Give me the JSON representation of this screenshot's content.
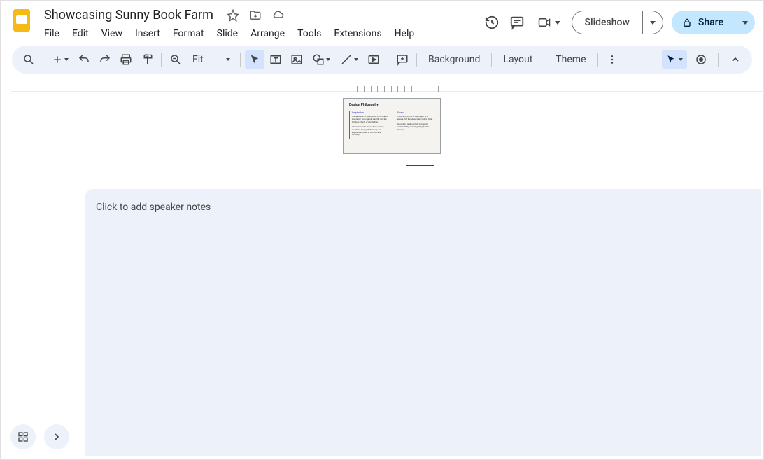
{
  "header": {
    "doc_title": "Showcasing Sunny Book Farm",
    "slideshow_label": "Slideshow",
    "share_label": "Share"
  },
  "menubar": [
    "File",
    "Edit",
    "View",
    "Insert",
    "Format",
    "Slide",
    "Arrange",
    "Tools",
    "Extensions",
    "Help"
  ],
  "toolbar": {
    "zoom_label": "Fit",
    "background_label": "Background",
    "layout_label": "Layout",
    "theme_label": "Theme"
  },
  "slide": {
    "title": "Design Philosophy",
    "col1_heading": "Inspiration",
    "col1_p1": "The aesthetic of Sunny Book Farm draws inspiration from nature, warmth, and the timeless charm of storytelling.",
    "col1_p2": "We envisioned a place where visitors could feel the joy of discovery—an experience rooted in comfort and curiosity.",
    "col2_heading": "Goals",
    "col2_p1": "The primary goal of the project is to ensure that the space feels inviting to all.",
    "col2_p2": "Secondary goals include promoting sustainability and integrating flexible layouts."
  },
  "notes": {
    "placeholder": "Click to add speaker notes"
  }
}
